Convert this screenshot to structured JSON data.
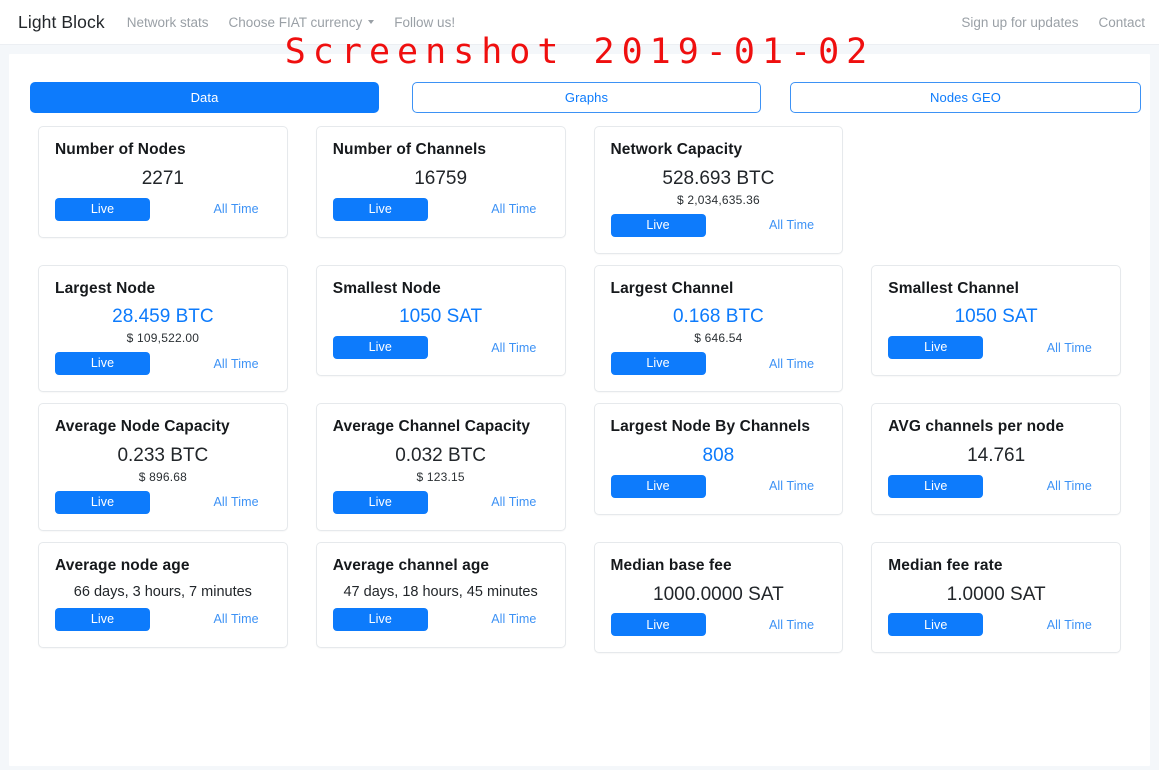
{
  "watermark": "Screenshot 2019-01-02",
  "navbar": {
    "brand": "Light Block",
    "links": [
      {
        "label": "Network stats",
        "caret": false
      },
      {
        "label": "Choose FIAT currency",
        "caret": true
      },
      {
        "label": "Follow us!",
        "caret": false
      }
    ],
    "right_links": [
      {
        "label": "Sign up for updates"
      },
      {
        "label": "Contact"
      }
    ]
  },
  "tabs": [
    {
      "label": "Data",
      "active": true
    },
    {
      "label": "Graphs",
      "active": false
    },
    {
      "label": "Nodes GEO",
      "active": false
    }
  ],
  "labels": {
    "live": "Live",
    "all_time": "All Time"
  },
  "colors": {
    "accent": "#0d7bfc",
    "link": "#3d92f5",
    "watermark": "#ef0f0f",
    "page_bg": "#f4f7fa",
    "card_border": "#e6e9ec"
  },
  "cards": [
    {
      "title": "Number of Nodes",
      "value": "2271",
      "value_is_link": false,
      "fiat": null
    },
    {
      "title": "Number of Channels",
      "value": "16759",
      "value_is_link": false,
      "fiat": null
    },
    {
      "title": "Network Capacity",
      "value": "528.693 BTC",
      "value_is_link": false,
      "fiat": "$ 2,034,635.36"
    },
    {
      "title": "",
      "value": "",
      "value_is_link": false,
      "fiat": null,
      "empty": true
    },
    {
      "title": "Largest Node",
      "value": "28.459 BTC",
      "value_is_link": true,
      "fiat": "$ 109,522.00"
    },
    {
      "title": "Smallest Node",
      "value": "1050 SAT",
      "value_is_link": true,
      "fiat": null
    },
    {
      "title": "Largest Channel",
      "value": "0.168 BTC",
      "value_is_link": true,
      "fiat": "$ 646.54"
    },
    {
      "title": "Smallest Channel",
      "value": "1050 SAT",
      "value_is_link": true,
      "fiat": null
    },
    {
      "title": "Average Node Capacity",
      "value": "0.233 BTC",
      "value_is_link": false,
      "fiat": "$ 896.68"
    },
    {
      "title": "Average Channel Capacity",
      "value": "0.032 BTC",
      "value_is_link": false,
      "fiat": "$ 123.15"
    },
    {
      "title": "Largest Node By Channels",
      "value": "808",
      "value_is_link": true,
      "fiat": null
    },
    {
      "title": "AVG channels per node",
      "value": "14.761",
      "value_is_link": false,
      "fiat": null
    },
    {
      "title": "Average node age",
      "value": "66 days, 3 hours, 7 minutes",
      "value_is_link": false,
      "value_small": true,
      "fiat": null
    },
    {
      "title": "Average channel age",
      "value": "47 days, 18 hours, 45 minutes",
      "value_is_link": false,
      "value_small": true,
      "fiat": null
    },
    {
      "title": "Median base fee",
      "value": "1000.0000 SAT",
      "value_is_link": false,
      "fiat": null
    },
    {
      "title": "Median fee rate",
      "value": "1.0000 SAT",
      "value_is_link": false,
      "fiat": null
    }
  ]
}
